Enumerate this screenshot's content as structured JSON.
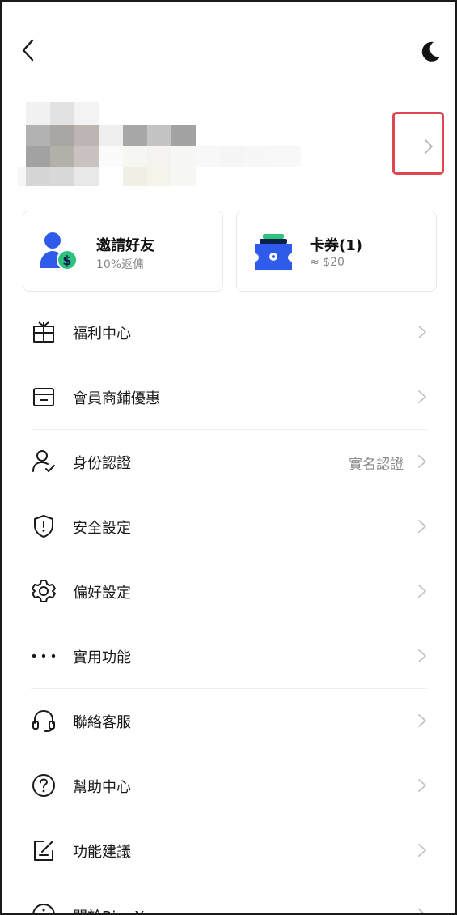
{
  "header": {
    "back_icon": "chevron-left-icon",
    "theme_icon": "moon-icon"
  },
  "profile": {
    "redacted": true,
    "chevron_icon": "chevron-right-icon",
    "highlight_color": "#e0464f"
  },
  "cards": [
    {
      "title": "邀請好友",
      "subtitle": "10%返傭",
      "icon": "invite-friend-icon"
    },
    {
      "title": "卡券(1)",
      "subtitle": "≈ $20",
      "icon": "coupon-icon"
    }
  ],
  "menu": {
    "items": [
      {
        "label": "福利中心",
        "icon": "gift-icon"
      },
      {
        "label": "會員商鋪優惠",
        "icon": "store-icon"
      },
      {
        "label": "身份認證",
        "icon": "user-verify-icon",
        "value": "實名認證"
      },
      {
        "label": "安全設定",
        "icon": "shield-icon"
      },
      {
        "label": "偏好設定",
        "icon": "gear-icon"
      },
      {
        "label": "實用功能",
        "icon": "more-dots-icon"
      },
      {
        "label": "聯絡客服",
        "icon": "headset-icon"
      },
      {
        "label": "幫助中心",
        "icon": "help-icon"
      },
      {
        "label": "功能建議",
        "icon": "edit-icon"
      },
      {
        "label": "關於BingX",
        "icon": "info-icon"
      }
    ]
  },
  "colors": {
    "accent_blue": "#2f5bea",
    "accent_green": "#2ec27e",
    "text": "#1a1a1a",
    "muted": "#8a8a8a"
  }
}
